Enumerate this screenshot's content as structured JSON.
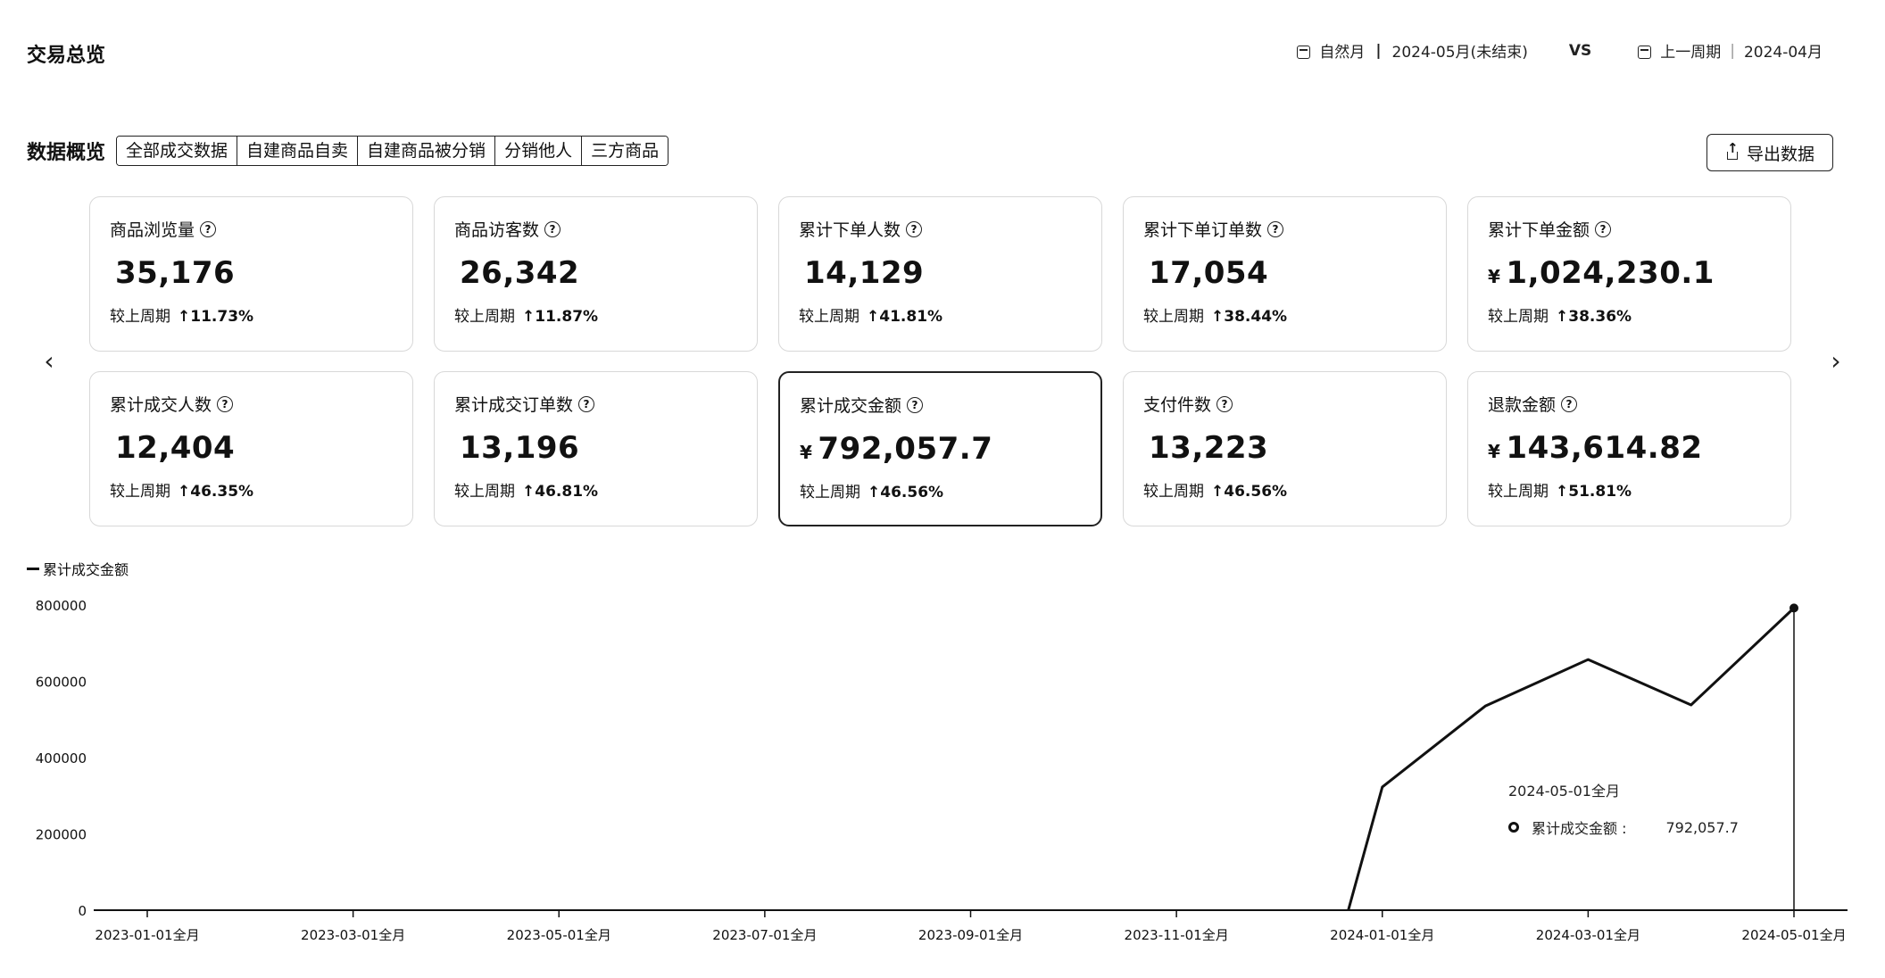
{
  "header": {
    "title": "交易总览",
    "period_type": "自然月",
    "period_value": "2024-05月(未结束)",
    "vs": "VS",
    "compare_type": "上一周期",
    "compare_value": "2024-04月"
  },
  "overview": {
    "title": "数据概览",
    "tabs": [
      "全部成交数据",
      "自建商品自卖",
      "自建商品被分销",
      "分销他人",
      "三方商品"
    ],
    "export_label": "导出数据",
    "compare_label": "较上周期",
    "cards": [
      {
        "label": "商品浏览量",
        "value": "35,176",
        "currency": "",
        "change": "↑11.73%"
      },
      {
        "label": "商品访客数",
        "value": "26,342",
        "currency": "",
        "change": "↑11.87%"
      },
      {
        "label": "累计下单人数",
        "value": "14,129",
        "currency": "",
        "change": "↑41.81%"
      },
      {
        "label": "累计下单订单数",
        "value": "17,054",
        "currency": "",
        "change": "↑38.44%"
      },
      {
        "label": "累计下单金额",
        "value": "1,024,230.1",
        "currency": "¥",
        "change": "↑38.36%"
      },
      {
        "label": "累计成交人数",
        "value": "12,404",
        "currency": "",
        "change": "↑46.35%"
      },
      {
        "label": "累计成交订单数",
        "value": "13,196",
        "currency": "",
        "change": "↑46.81%"
      },
      {
        "label": "累计成交金额",
        "value": "792,057.7",
        "currency": "¥",
        "change": "↑46.56%"
      },
      {
        "label": "支付件数",
        "value": "13,223",
        "currency": "",
        "change": "↑46.56%"
      },
      {
        "label": "退款金额",
        "value": "143,614.82",
        "currency": "¥",
        "change": "↑51.81%"
      }
    ]
  },
  "chart_data": {
    "type": "line",
    "series": [
      {
        "name": "累计成交金额",
        "values": [
          0,
          0,
          0,
          0,
          0,
          0,
          0,
          0,
          0,
          0,
          0,
          0,
          0,
          323000,
          535000,
          657000,
          538000,
          792057.7
        ]
      }
    ],
    "x": [
      "2023-01-01全月",
      "2023-02-01全月",
      "2023-03-01全月",
      "2023-04-01全月",
      "2023-05-01全月",
      "2023-06-01全月",
      "2023-07-01全月",
      "2023-08-01全月",
      "2023-09-01全月",
      "2023-10-01全月",
      "2023-11-01全月",
      "2023-12-01全月",
      "2023-12-15全月",
      "2024-01-01全月",
      "2024-02-01全月",
      "2024-03-01全月",
      "2024-04-01全月",
      "2024-05-01全月"
    ],
    "x_tick_labels": [
      "2023-01-01全月",
      "2023-03-01全月",
      "2023-05-01全月",
      "2023-07-01全月",
      "2023-09-01全月",
      "2023-11-01全月",
      "2024-01-01全月",
      "2024-03-01全月",
      "2024-05-01全月"
    ],
    "y_tick_labels": [
      "0",
      "200000",
      "400000",
      "600000",
      "800000"
    ],
    "ylim": [
      0,
      800000
    ],
    "legend": "top-left",
    "tooltip": {
      "title": "2024-05-01全月",
      "label": "累计成交金额 :",
      "value": "792,057.7"
    },
    "grid": false
  }
}
